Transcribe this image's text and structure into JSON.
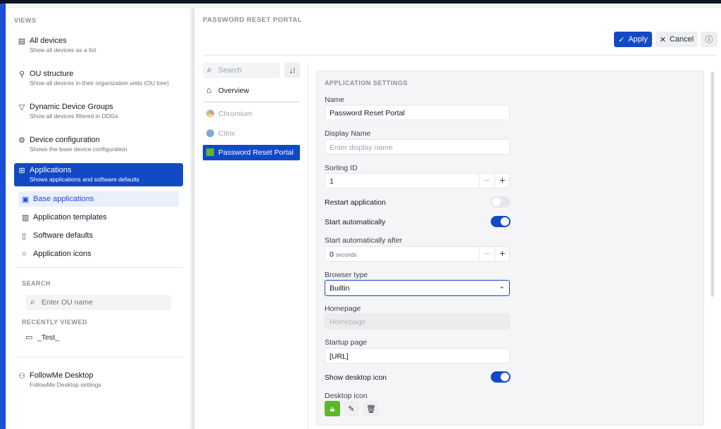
{
  "sidebar": {
    "views_label": "VIEWS",
    "items": [
      {
        "title": "All devices",
        "subtitle": "Show all devices as a list"
      },
      {
        "title": "OU structure",
        "subtitle": "Show all devices in their organization units (OU tree)"
      },
      {
        "title": "Dynamic Device Groups",
        "subtitle": "Show all devices filtered in DDGs"
      },
      {
        "title": "Device configuration",
        "subtitle": "Shows the base device configuration"
      },
      {
        "title": "Applications",
        "subtitle": "Shows applications and software defaults"
      }
    ],
    "subitems": [
      "Base applications",
      "Application templates",
      "Software defaults",
      "Application icons"
    ],
    "search_label": "SEARCH",
    "search_placeholder": "Enter OU name",
    "recent_label": "RECENTLY VIEWED",
    "recent_items": [
      "_Test_"
    ],
    "followme": {
      "title": "FollowMe Desktop",
      "subtitle": "FollowMe Desktop settings"
    }
  },
  "main": {
    "title": "PASSWORD RESET PORTAL",
    "apply": "Apply",
    "cancel": "Cancel",
    "app_search_placeholder": "Search",
    "overview": "Overview",
    "apps": [
      "Chromium",
      "Citrix",
      "Password Reset Portal"
    ],
    "settings": {
      "heading": "APPLICATION SETTINGS",
      "name_label": "Name",
      "name_value": "Password Reset Portal",
      "display_name_label": "Display Name",
      "display_name_placeholder": "Enter display name",
      "sorting_label": "Sorting ID",
      "sorting_value": "1",
      "restart_label": "Restart application",
      "restart_on": false,
      "autostart_label": "Start automatically",
      "autostart_on": true,
      "autostart_after_label": "Start automatically after",
      "autostart_after_value": "0",
      "autostart_after_unit": "seconds",
      "browser_label": "Browser type",
      "browser_value": "Builtin",
      "homepage_label": "Homepage",
      "homepage_placeholder": "Homepage",
      "startup_label": "Startup page",
      "startup_value": "[URL]",
      "show_icon_label": "Show desktop icon",
      "show_icon_on": true,
      "desktop_icon_label": "Desktop icon"
    }
  },
  "colors": {
    "accent": "#1249c4",
    "icon_green": "#5cb82a"
  }
}
